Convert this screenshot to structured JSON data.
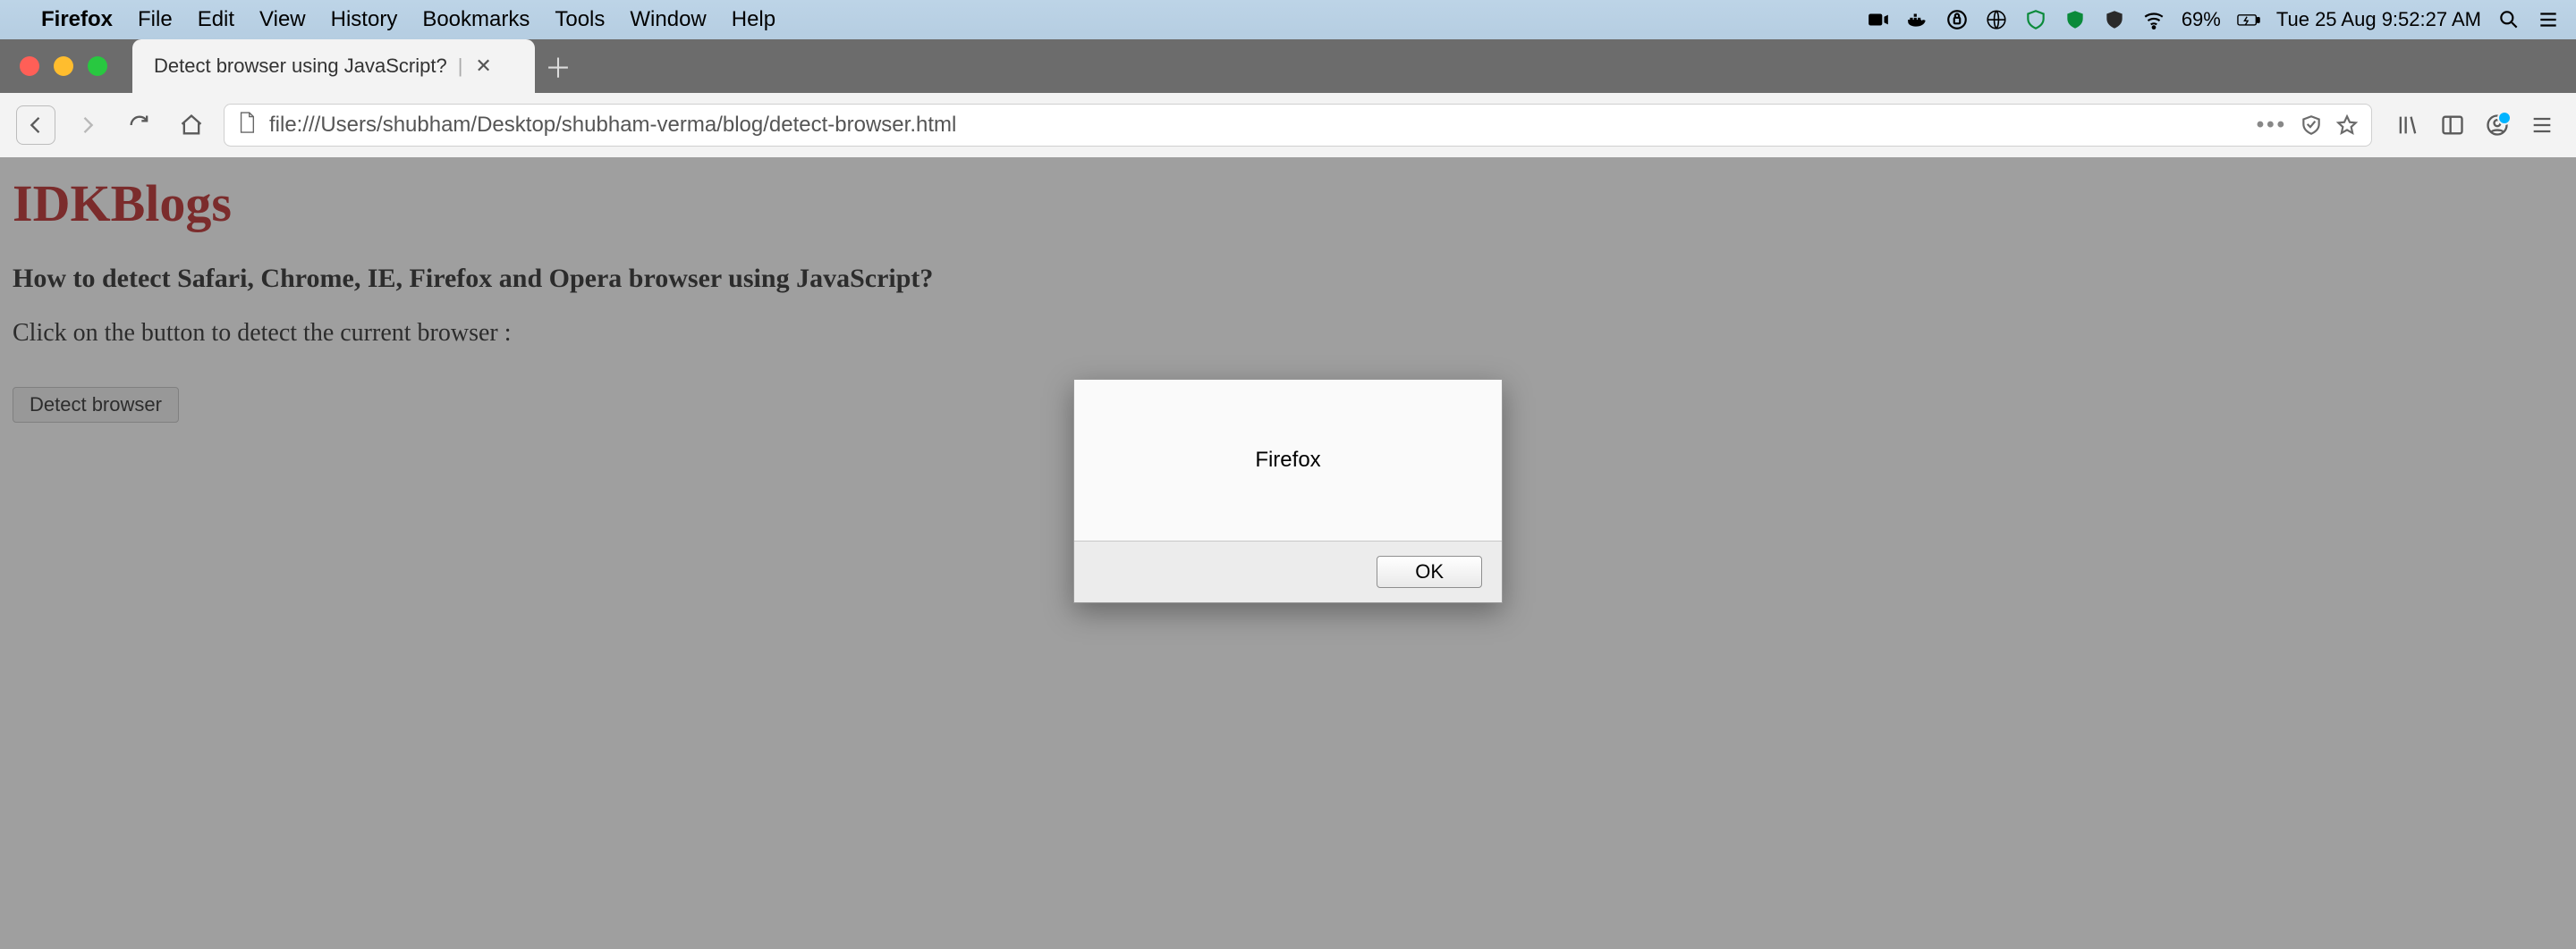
{
  "menubar": {
    "app_name": "Firefox",
    "items": [
      "File",
      "Edit",
      "View",
      "History",
      "Bookmarks",
      "Tools",
      "Window",
      "Help"
    ],
    "battery_percent": "69%",
    "clock": "Tue 25 Aug  9:52:27 AM"
  },
  "tab": {
    "title": "Detect browser using JavaScript?"
  },
  "urlbar": {
    "url": "file:///Users/shubham/Desktop/shubham-verma/blog/detect-browser.html"
  },
  "page": {
    "site_title": "IDKBlogs",
    "heading": "How to detect Safari, Chrome, IE, Firefox and Opera browser using JavaScript?",
    "instruction": "Click on the button to detect the current browser :",
    "detect_button_label": "Detect browser"
  },
  "alert": {
    "message": "Firefox",
    "ok_label": "OK"
  }
}
